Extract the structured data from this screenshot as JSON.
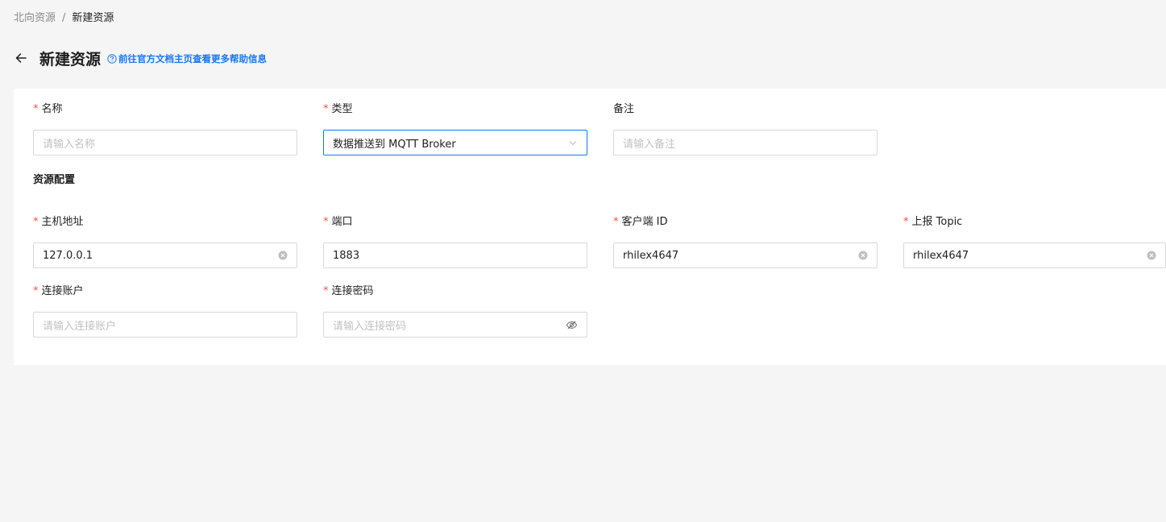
{
  "breadcrumb": {
    "parent": "北向资源",
    "separator": "/",
    "current": "新建资源"
  },
  "header": {
    "title": "新建资源",
    "help_link": "前往官方文档主页查看更多帮助信息"
  },
  "form": {
    "name": {
      "label": "名称",
      "required": true,
      "placeholder": "请输入名称",
      "value": ""
    },
    "type": {
      "label": "类型",
      "required": true,
      "value": "数据推送到 MQTT Broker"
    },
    "remark": {
      "label": "备注",
      "required": false,
      "placeholder": "请输入备注",
      "value": ""
    },
    "section_title": "资源配置",
    "host": {
      "label": "主机地址",
      "required": true,
      "value": "127.0.0.1"
    },
    "port": {
      "label": "端口",
      "required": true,
      "value": "1883"
    },
    "client_id": {
      "label": "客户端 ID",
      "required": true,
      "value": "rhilex4647"
    },
    "topic": {
      "label": "上报 Topic",
      "required": true,
      "value": "rhilex4647"
    },
    "username": {
      "label": "连接账户",
      "required": true,
      "placeholder": "请输入连接账户",
      "value": ""
    },
    "password": {
      "label": "连接密码",
      "required": true,
      "placeholder": "请输入连接密码",
      "value": ""
    }
  },
  "colors": {
    "accent": "#1677ff",
    "required_mark": "#ff4d4f",
    "page_bg": "#f5f5f5"
  },
  "icons": {
    "back": "arrow-left-icon",
    "help": "question-circle-icon",
    "select": "chevron-down-icon",
    "clear": "close-circle-icon",
    "password_toggle": "eye-invisible-icon"
  }
}
